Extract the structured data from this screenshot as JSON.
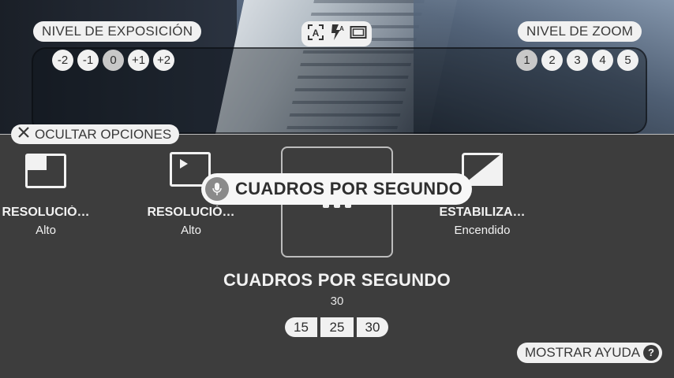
{
  "exposure": {
    "label": "NIVEL DE EXPOSICIÓN",
    "levels": [
      "-2",
      "-1",
      "0",
      "+1",
      "+2"
    ],
    "selected": "0"
  },
  "zoom": {
    "label": "NIVEL DE ZOOM",
    "levels": [
      "1",
      "2",
      "3",
      "4",
      "5"
    ],
    "selected": "1"
  },
  "toggles": {
    "auto_focus_icon": "auto-focus-icon",
    "flash_icon": "flash-auto-icon",
    "aspect_icon": "aspect-ratio-icon"
  },
  "hide_options": {
    "label": "OCULTAR OPCIONES",
    "icon": "close-icon"
  },
  "options": [
    {
      "title": "RESOLUCIÓ…",
      "value": "Alto",
      "icon": "photo-resolution-icon"
    },
    {
      "title": "RESOLUCIÓ…",
      "value": "Alto",
      "icon": "video-resolution-icon"
    },
    {
      "title": "CUADROS POR SEGUNDO",
      "value": "30",
      "icon": "frame-rate-icon"
    },
    {
      "title": "ESTABILIZA…",
      "value": "Encendido",
      "icon": "stabilization-icon"
    }
  ],
  "tooltip": {
    "text": "CUADROS POR SEGUNDO",
    "icon": "microphone-icon"
  },
  "selected_setting": {
    "title": "CUADROS POR SEGUNDO",
    "value": "30",
    "choices": [
      "15",
      "25",
      "30"
    ]
  },
  "help": {
    "label": "MOSTRAR AYUDA",
    "icon": "question-icon",
    "glyph": "?"
  },
  "colors": {
    "panel": "#3d3d3d",
    "chip": "#f1f1f1",
    "chip_active": "#c8c8c8"
  }
}
